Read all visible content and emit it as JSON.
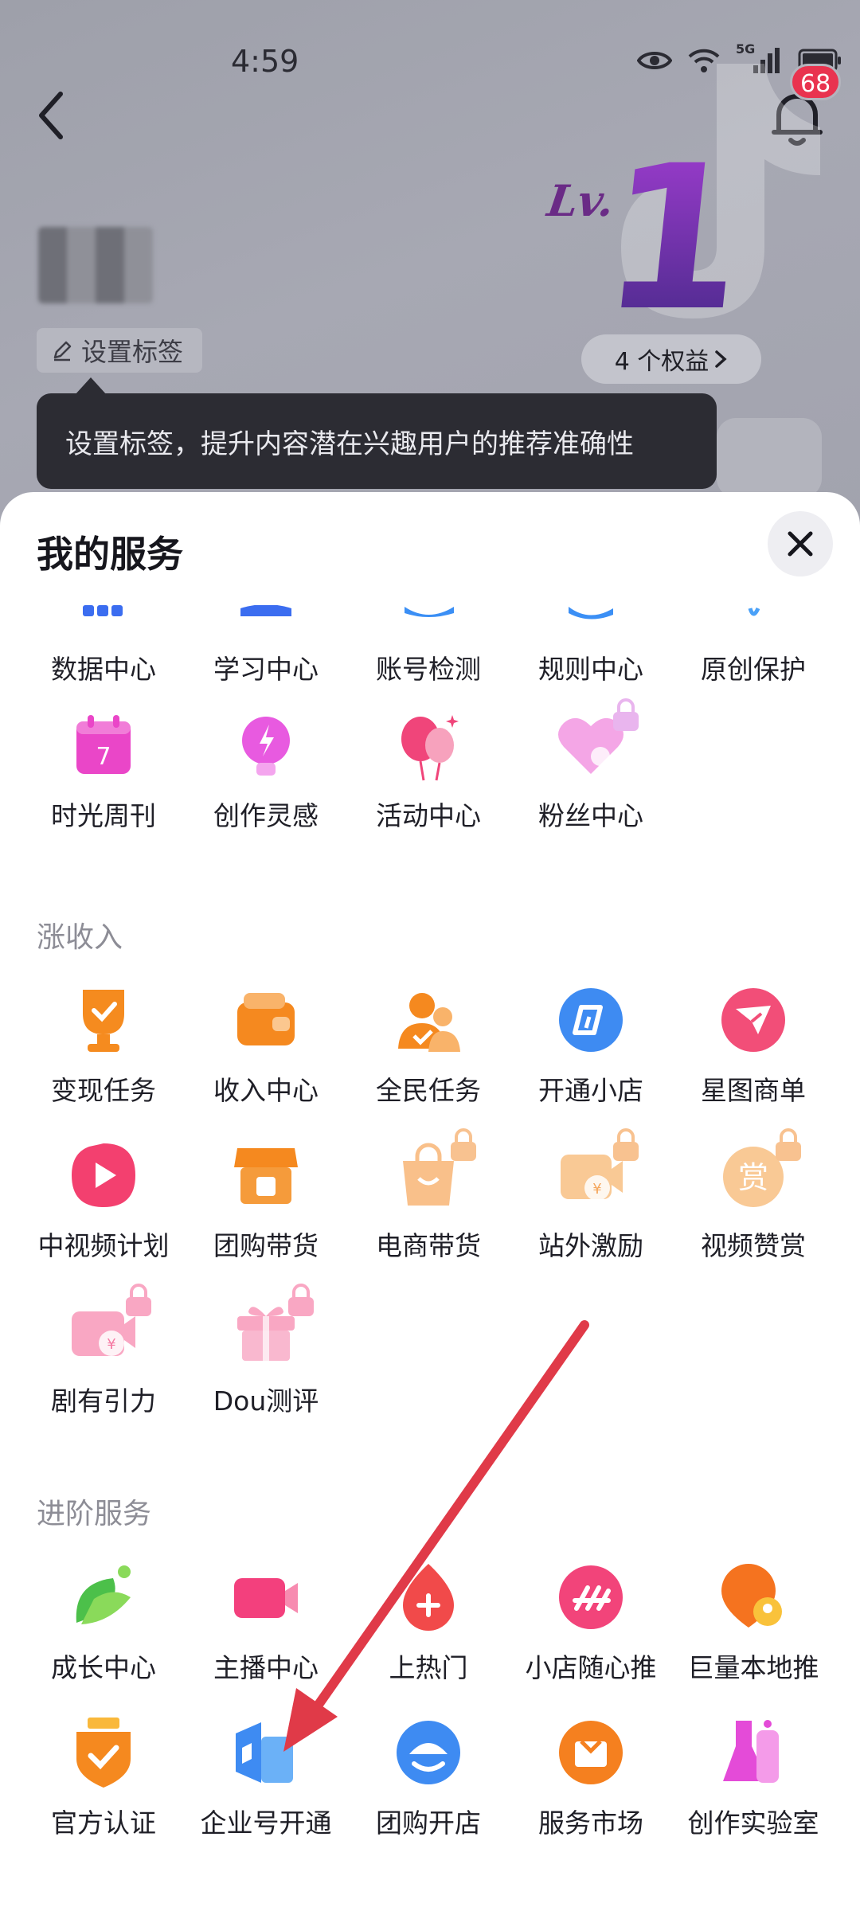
{
  "status_bar": {
    "time": "4:59",
    "network": "5G"
  },
  "header": {
    "notification_count": "68"
  },
  "profile": {
    "level_prefix": "Lv.",
    "level_number": "1",
    "rights_label": "4 个权益",
    "tag_button": "设置标签",
    "tooltip": "设置标签，提升内容潜在兴趣用户的推荐准确性"
  },
  "sheet": {
    "title": "我的服务",
    "row_partial": [
      "数据中心",
      "学习中心",
      "账号检测",
      "规则中心",
      "原创保护"
    ],
    "row_basic": [
      "时光周刊",
      "创作灵感",
      "活动中心",
      "粉丝中心"
    ],
    "income": {
      "label": "涨收入",
      "row1": [
        "变现任务",
        "收入中心",
        "全民任务",
        "开通小店",
        "星图商单"
      ],
      "row2": [
        "中视频计划",
        "团购带货",
        "电商带货",
        "站外激励",
        "视频赞赏"
      ],
      "row3": [
        "剧有引力",
        "Dou测评"
      ]
    },
    "advanced": {
      "label": "进阶服务",
      "row1": [
        "成长中心",
        "主播中心",
        "上热门",
        "小店随心推",
        "巨量本地推"
      ],
      "row2": [
        "官方认证",
        "企业号开通",
        "团购开店",
        "服务市场",
        "创作实验室"
      ]
    }
  },
  "colors": {
    "accent_red": "#e9334f",
    "arrow": "#e03a48"
  }
}
